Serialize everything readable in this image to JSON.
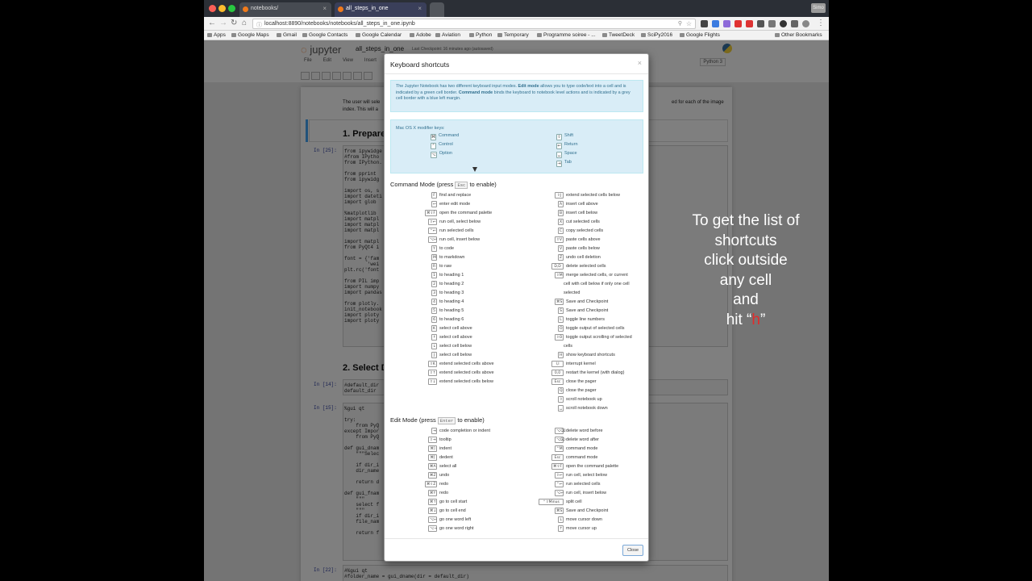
{
  "browser": {
    "tabs": [
      {
        "label": "notebooks/",
        "active": false
      },
      {
        "label": "all_steps_in_one",
        "active": true
      }
    ],
    "url": "localhost:8890/notebooks/notebooks/all_steps_in_one.ipynb",
    "bookmarks": [
      "Apps",
      "Google Maps",
      "Gmail",
      "Google Contacts",
      "Google Calendar",
      "Adobe",
      "Aviation",
      "Python",
      "Temporary",
      "Programme soiree - ...",
      "TweetDeck",
      "SciPy2016",
      "Google Flights",
      "Other Bookmarks"
    ],
    "profile": "Simo"
  },
  "notebook": {
    "logo": "jupyter",
    "title": "all_steps_in_one",
    "checkpoint": "Last Checkpoint: 16 minutes ago (autosaved)",
    "menu": [
      "File",
      "Edit",
      "View",
      "Insert"
    ],
    "kernel": "Python 3",
    "intro_text_left": "The user will sele",
    "intro_text_left2": "index. This will a",
    "intro_text_right": "ed for each of the image",
    "heading1": "1. Prepare",
    "heading2": "2. Select D",
    "prompts": [
      "In [25]:",
      "In [14]:",
      "In [15]:",
      "In [22]:"
    ],
    "cell1": "from ipywidge\n#from IPytho\nfrom IPython.\n\nfrom pprint\nfrom ipywidg\n\nimport os, s\nimport dateti\nimport glob\n\n%matplotlib\nimport matpl\nimport matpl\nimport matpl\n\nimport matpl\nfrom PyQt4 i\n\nfont = {'fam\n        'wei\nplt.rc('font\n\nfrom PIL imp\nimport numpy\nimport pandas\n\nfrom plotly.\ninit_notebook\nimport ploty\nimport ploty",
    "cell2": "#default_dir\ndefault_dir",
    "cell3": "%gui qt\n\ntry:\n    from PyQ\nexcept Impor\n    from PyQ\n\ndef gui_dnam\n    \"\"\"Selec\n\n    if dir_i\n    dir_name\n\n    return d\n\ndef gui_fnam\n    \"\"\"\n    select f\n    \"\"\"\n    if dir_i\n    file_nam\n\n    return f",
    "cell4": "#%gui qt\n#folder_name = gui_dname(dir = default_dir)"
  },
  "modal": {
    "title": "Keyboard shortcuts",
    "close_x": "×",
    "info_prefix": "The Jupyter Notebook has two different keyboard input modes. ",
    "info_edit": "Edit mode",
    "info_mid": " allows you to type code/text into a cell and is indicated by a green cell border. ",
    "info_command": "Command mode",
    "info_suffix": " binds the keyboard to notebook level actions and is indicated by a grey cell border with a blue left margin.",
    "modifier_label": "Mac OS X modifier keys:",
    "modifiers": [
      {
        "key": "⌘",
        "label": "Command"
      },
      {
        "key": "⌃",
        "label": "Control"
      },
      {
        "key": "⌥",
        "label": "Option"
      },
      {
        "key": "⇧",
        "label": "Shift"
      },
      {
        "key": "↩",
        "label": "Return"
      },
      {
        "key": "␣",
        "label": "Space"
      },
      {
        "key": "⇥",
        "label": "Tab"
      }
    ],
    "command_mode_pre": "Command Mode (press ",
    "command_mode_key": "Esc",
    "command_mode_post": " to enable)",
    "edit_mode_pre": "Edit Mode (press ",
    "edit_mode_key": "Enter",
    "edit_mode_post": " to enable)",
    "command_left": [
      {
        "k": "F",
        "d": "find and replace"
      },
      {
        "k": "↩",
        "d": "enter edit mode"
      },
      {
        "k": "⌘⇧F",
        "d": "open the command palette"
      },
      {
        "k": "⇧↩",
        "d": "run cell, select below"
      },
      {
        "k": "⌃↩",
        "d": "run selected cells"
      },
      {
        "k": "⌥↩",
        "d": "run cell, insert below"
      },
      {
        "k": "Y",
        "d": "to code"
      },
      {
        "k": "M",
        "d": "to markdown"
      },
      {
        "k": "R",
        "d": "to raw"
      },
      {
        "k": "1",
        "d": "to heading 1"
      },
      {
        "k": "2",
        "d": "to heading 2"
      },
      {
        "k": "3",
        "d": "to heading 3"
      },
      {
        "k": "4",
        "d": "to heading 4"
      },
      {
        "k": "5",
        "d": "to heading 5"
      },
      {
        "k": "6",
        "d": "to heading 6"
      },
      {
        "k": "K",
        "d": "select cell above"
      },
      {
        "k": "↑",
        "d": "select cell above"
      },
      {
        "k": "↓",
        "d": "select cell below"
      },
      {
        "k": "J",
        "d": "select cell below"
      },
      {
        "k": "⇧K",
        "d": "extend selected cells above"
      },
      {
        "k": "⇧↑",
        "d": "extend selected cells above"
      },
      {
        "k": "⇧↓",
        "d": "extend selected cells below"
      }
    ],
    "command_right": [
      {
        "k": "⇧J",
        "d": "extend selected cells below"
      },
      {
        "k": "A",
        "d": "insert cell above"
      },
      {
        "k": "B",
        "d": "insert cell below"
      },
      {
        "k": "X",
        "d": "cut selected cells"
      },
      {
        "k": "C",
        "d": "copy selected cells"
      },
      {
        "k": "⇧V",
        "d": "paste cells above"
      },
      {
        "k": "V",
        "d": "paste cells below"
      },
      {
        "k": "Z",
        "d": "undo cell deletion"
      },
      {
        "k": "D,D",
        "d": "delete selected cells"
      },
      {
        "k": "⇧M",
        "d": "merge selected cells, or current"
      },
      {
        "k": "",
        "d": "cell with cell below if only one cell"
      },
      {
        "k": "",
        "d": "selected"
      },
      {
        "k": "⌘S",
        "d": "Save and Checkpoint"
      },
      {
        "k": "S",
        "d": "Save and Checkpoint"
      },
      {
        "k": "L",
        "d": "toggle line numbers"
      },
      {
        "k": "O",
        "d": "toggle output of selected cells"
      },
      {
        "k": "⇧O",
        "d": "toggle output scrolling of selected"
      },
      {
        "k": "",
        "d": "cells"
      },
      {
        "k": "H",
        "d": "show keyboard shortcuts"
      },
      {
        "k": "I,I",
        "d": "interrupt kernel"
      },
      {
        "k": "0,0",
        "d": "restart the kernel (with dialog)"
      },
      {
        "k": "Esc",
        "d": "close the pager"
      },
      {
        "k": "Q",
        "d": "close the pager"
      },
      {
        "k": "⇧",
        "d": "scroll notebook up"
      },
      {
        "k": "␣",
        "d": "scroll notebook down"
      }
    ],
    "edit_left": [
      {
        "k": "⇥",
        "d": "code completion or indent"
      },
      {
        "k": "⇧⇥",
        "d": "tooltip"
      },
      {
        "k": "⌘]",
        "d": "indent"
      },
      {
        "k": "⌘[",
        "d": "dedent"
      },
      {
        "k": "⌘A",
        "d": "select all"
      },
      {
        "k": "⌘Z",
        "d": "undo"
      },
      {
        "k": "⌘⇧Z",
        "d": "redo"
      },
      {
        "k": "⌘Y",
        "d": "redo"
      },
      {
        "k": "⌘↑",
        "d": "go to cell start"
      },
      {
        "k": "⌘↓",
        "d": "go to cell end"
      },
      {
        "k": "⌥←",
        "d": "go one word left"
      },
      {
        "k": "⌥→",
        "d": "go one word right"
      }
    ],
    "edit_right": [
      {
        "k": "⌥⌫",
        "d": "delete word before"
      },
      {
        "k": "⌥⌦",
        "d": "delete word after"
      },
      {
        "k": "⌃M",
        "d": "command mode"
      },
      {
        "k": "Esc",
        "d": "command mode"
      },
      {
        "k": "⌘⇧F",
        "d": "open the command palette"
      },
      {
        "k": "⇧↩",
        "d": "run cell, select below"
      },
      {
        "k": "⌃↩",
        "d": "run selected cells"
      },
      {
        "k": "⌥↩",
        "d": "run cell, insert below"
      },
      {
        "k": "⌃⇧Minus",
        "d": "split cell"
      },
      {
        "k": "⌘S",
        "d": "Save and Checkpoint"
      },
      {
        "k": "↓",
        "d": "move cursor down"
      },
      {
        "k": "↑",
        "d": "move cursor up"
      }
    ],
    "close_button": "Close"
  },
  "caption": {
    "lines": [
      "To get the list of",
      "shortcuts",
      "click outside",
      "any cell",
      "and"
    ],
    "last_prefix": "hit “",
    "last_key": "h",
    "last_suffix": "”",
    "key_color": "#e32b2b"
  }
}
